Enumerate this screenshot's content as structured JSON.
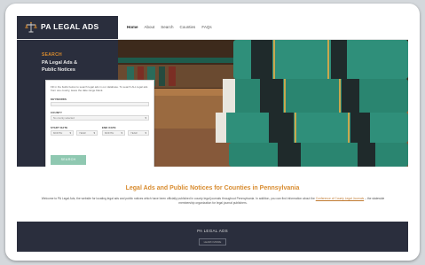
{
  "brand": {
    "name": "PA LEGAL ADS"
  },
  "nav": {
    "items": [
      {
        "label": "Home",
        "active": true
      },
      {
        "label": "About",
        "active": false
      },
      {
        "label": "Search",
        "active": false
      },
      {
        "label": "Counties",
        "active": false
      },
      {
        "label": "FAQs",
        "active": false
      }
    ]
  },
  "hero": {
    "kicker": "SEARCH",
    "title_line1": "PA Legal Ads &",
    "title_line2": "Public Notices"
  },
  "search": {
    "intro": "Fill in the fields below to search legal ads in our database. To search ALL legal ads from one county, leave the date range blank.",
    "keywords_label": "KEYWORDS",
    "keywords_value": "",
    "county_label": "COUNTY",
    "county_value": "No county selected",
    "start_date_label": "START DATE",
    "end_date_label": "END DATE",
    "month_placeholder": "MONTH",
    "year_placeholder": "YEAR",
    "button_label": "SEARCH"
  },
  "info": {
    "title": "Legal Ads and Public Notices for Counties in Pennsylvania",
    "text_before": "Welcome to PA Legal Ads, the website for locating legal ads and public notices which have been officially published in county legal journals throughout Pennsylvania. In addition, you can find information about the ",
    "link": "Conference of County Legal Journals",
    "text_after": " – the statewide membership organization for legal journal publishers."
  },
  "footer": {
    "title": "PA LEGAL ADS",
    "button_label": "LEARN MORE"
  },
  "colors": {
    "dark_navy": "#2a2e3d",
    "accent_orange": "#d88b2e",
    "button_teal": "#8fc8b1",
    "book_green": "#2f8f7a"
  }
}
